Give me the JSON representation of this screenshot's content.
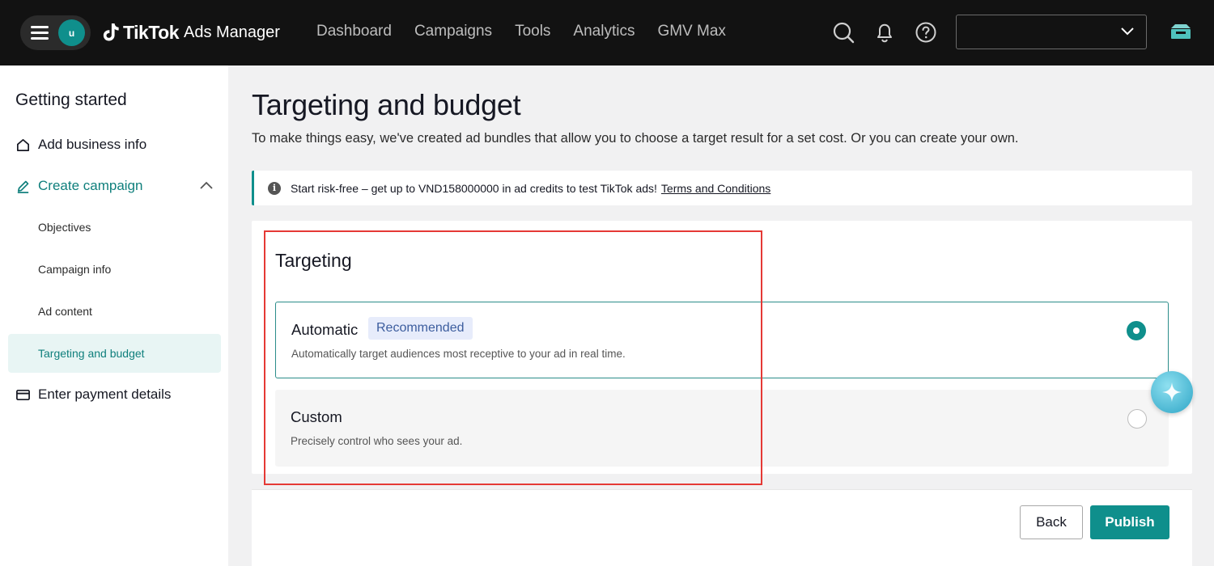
{
  "topbar": {
    "avatar_initial": "u",
    "brand": "TikTok",
    "product": "Ads Manager",
    "nav": [
      "Dashboard",
      "Campaigns",
      "Tools",
      "Analytics",
      "GMV Max"
    ],
    "account_selector_value": ""
  },
  "sidebar": {
    "title": "Getting started",
    "items": [
      {
        "label": "Add business info",
        "icon": "house-icon"
      },
      {
        "label": "Create campaign",
        "icon": "pencil-icon",
        "active": true
      },
      {
        "label": "Enter payment details",
        "icon": "card-icon"
      }
    ],
    "subitems": [
      "Objectives",
      "Campaign info",
      "Ad content",
      "Targeting and budget"
    ],
    "active_subitem": "Targeting and budget"
  },
  "main": {
    "title": "Targeting and budget",
    "subtitle": "To make things easy, we've created ad bundles that allow you to choose a target result for a set cost. Or you can create your own.",
    "banner": {
      "text": "Start risk-free – get up to VND158000000 in ad credits to test TikTok ads!",
      "link": "Terms and Conditions"
    },
    "targeting": {
      "heading": "Targeting",
      "options": [
        {
          "name": "Automatic",
          "badge": "Recommended",
          "description": "Automatically target audiences most receptive to your ad in real time.",
          "selected": true
        },
        {
          "name": "Custom",
          "description": "Precisely control who sees your ad.",
          "selected": false
        }
      ]
    },
    "footer": {
      "back_label": "Back",
      "publish_label": "Publish"
    }
  },
  "colors": {
    "accent": "#0f8f8c",
    "highlight": "#e53935",
    "topbar": "#121212"
  }
}
